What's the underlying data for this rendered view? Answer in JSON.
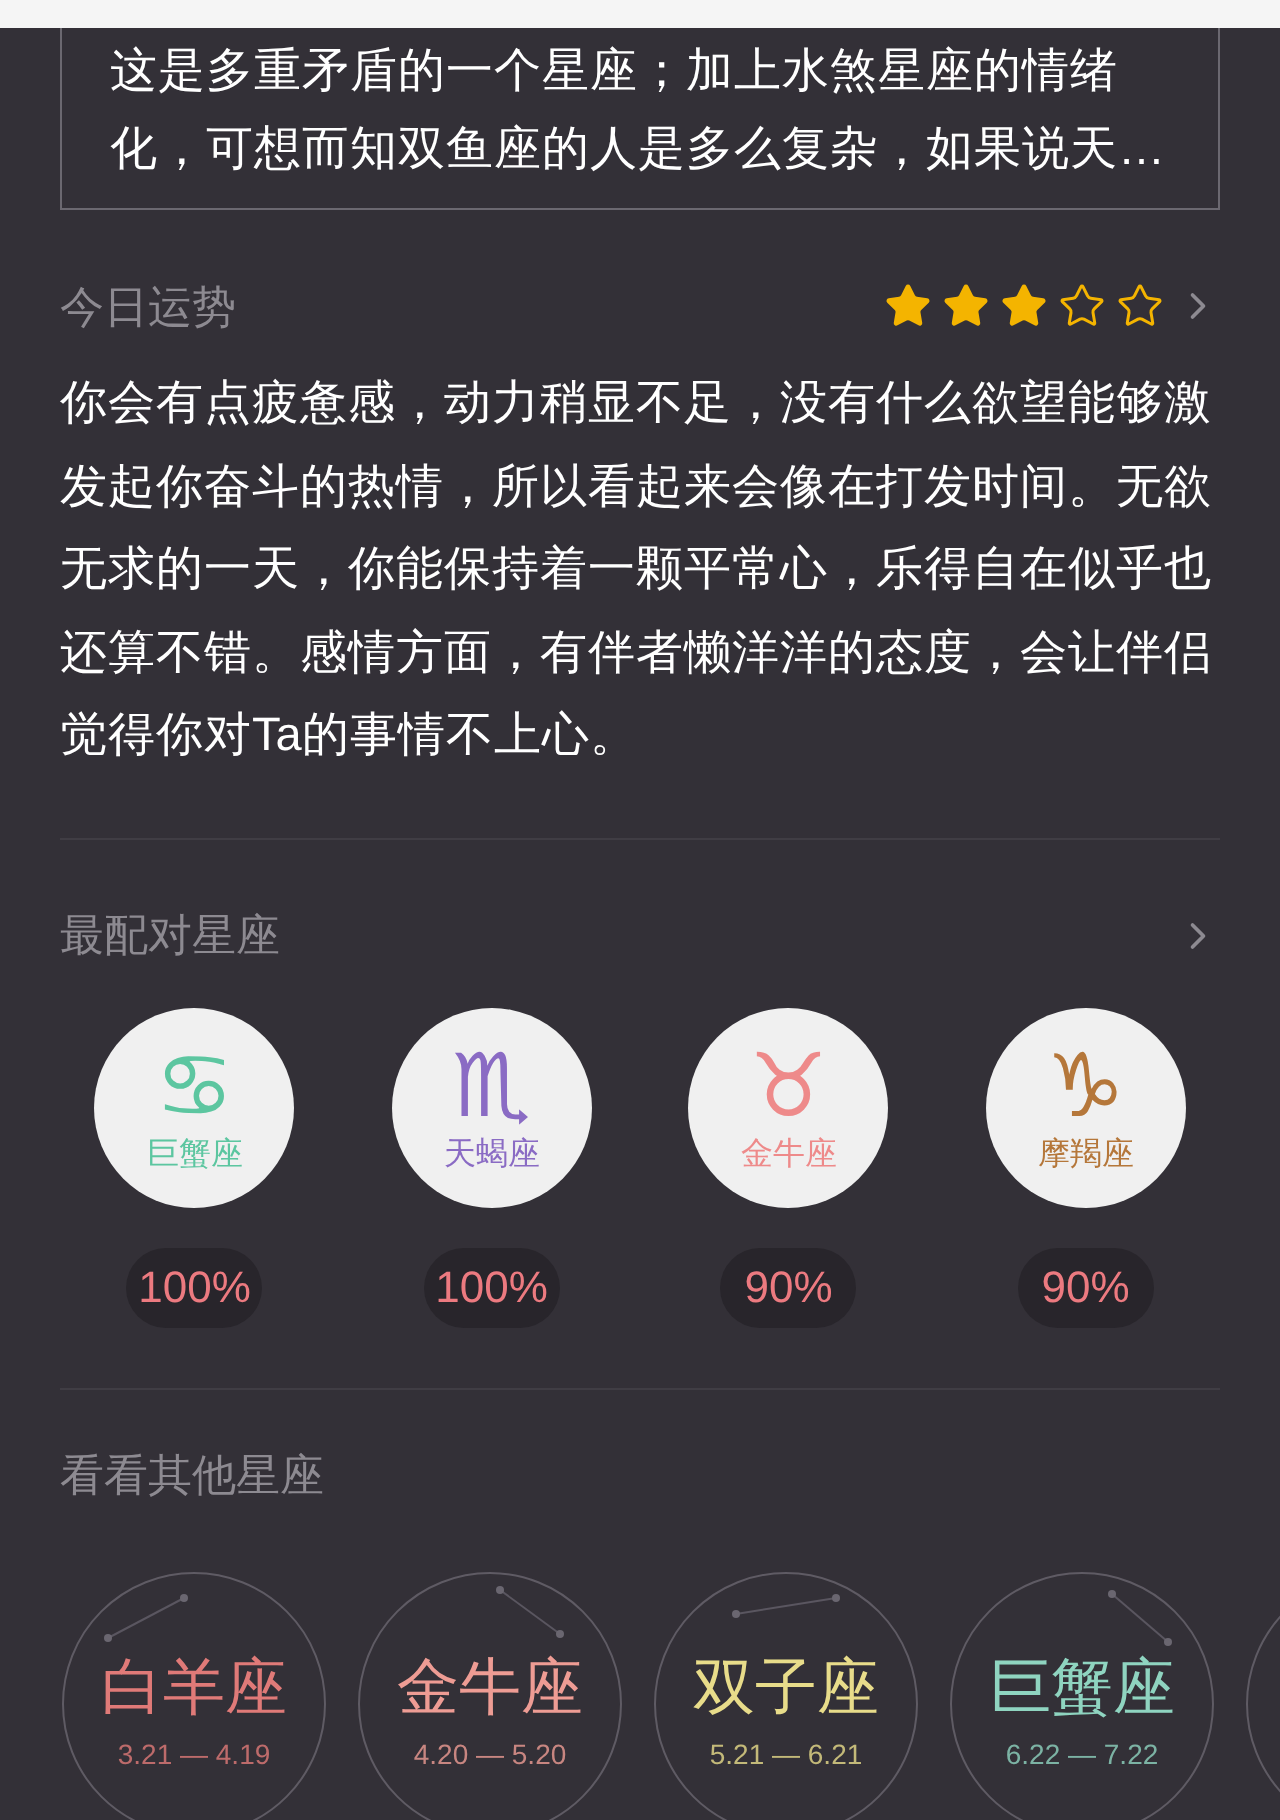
{
  "summary": {
    "text": "这是多重矛盾的一个星座；加上水煞星座的情绪化，可想而知双鱼座的人是多么复杂，如果说天…"
  },
  "today": {
    "title": "今日运势",
    "stars": 3,
    "text": "你会有点疲惫感，动力稍显不足，没有什么欲望能够激发起你奋斗的热情，所以看起来会像在打发时间。无欲无求的一天，你能保持着一颗平常心，乐得自在似乎也还算不错。感情方面，有伴者懒洋洋的态度，会让伴侣觉得你对Ta的事情不上心。"
  },
  "matches": {
    "title": "最配对星座",
    "items": [
      {
        "symbol": "♋",
        "name": "巨蟹座",
        "color": "#5cc6a0",
        "percent": "100%"
      },
      {
        "symbol": "♏",
        "name": "天蝎座",
        "color": "#8a6bc4",
        "percent": "100%"
      },
      {
        "symbol": "♉",
        "name": "金牛座",
        "color": "#ee8a8a",
        "percent": "90%"
      },
      {
        "symbol": "♑",
        "name": "摩羯座",
        "color": "#b5773a",
        "percent": "90%"
      }
    ]
  },
  "others": {
    "title": "看看其他星座",
    "items": [
      {
        "name": "白羊座",
        "dates": "3.21 — 4.19",
        "color": "#e07a78"
      },
      {
        "name": "金牛座",
        "dates": "4.20 — 5.20",
        "color": "#ee9c94"
      },
      {
        "name": "双子座",
        "dates": "5.21 — 6.21",
        "color": "#e8dc8a"
      },
      {
        "name": "巨蟹座",
        "dates": "6.22 — 7.22",
        "color": "#8fd4c0"
      }
    ]
  }
}
